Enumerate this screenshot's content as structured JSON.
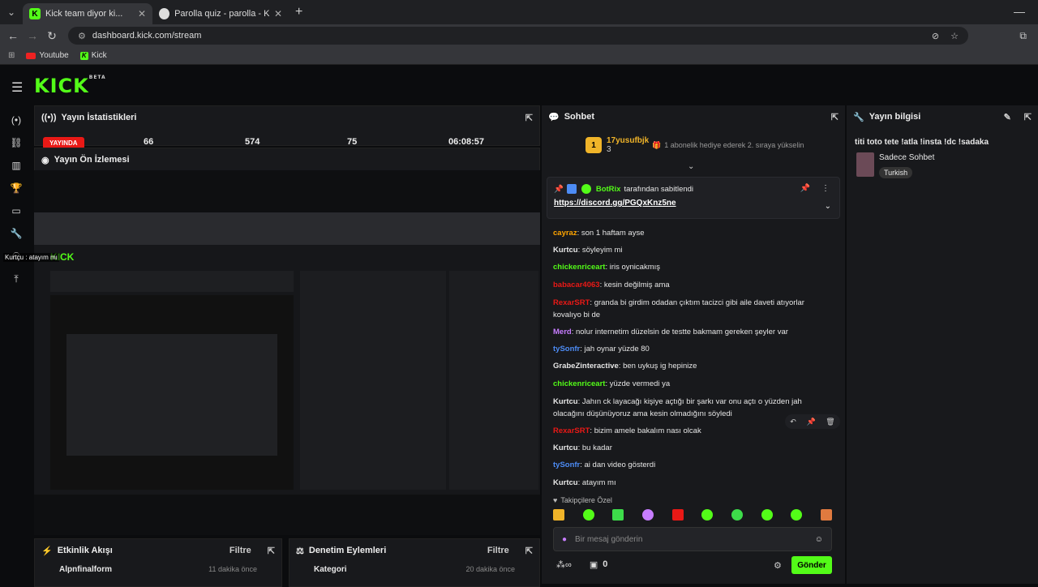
{
  "browser": {
    "tabs": [
      {
        "label": "Kick team diyor ki...",
        "active": true
      },
      {
        "label": "Parolla quiz - parolla - Kelime o",
        "active": false
      }
    ],
    "url": "dashboard.kick.com/stream",
    "bookmarks": [
      {
        "label": "Youtube"
      },
      {
        "label": "Kick"
      }
    ]
  },
  "brand": {
    "logo": "KICK",
    "beta": "BETA",
    "accent": "#53fc18"
  },
  "stats": {
    "title": "Yayın İstatistikleri",
    "live": "YAYINDA",
    "values": [
      "66",
      "574",
      "75",
      "06:08:57"
    ]
  },
  "preview": {
    "title": "Yayın Ön İzlemesi",
    "overlay": "Kurtçu : atayım mı"
  },
  "chat": {
    "title": "Sohbet",
    "top_user": "17yusufbjk",
    "top_count": "3",
    "sub_hint": "1 abonelik hediye ederek 2. sıraya yükselin",
    "pinned_by": "BotRix",
    "pinned_suffix": "tarafından sabitlendi",
    "pinned_link": "https://discord.gg/PGQxKnz5ne",
    "messages": [
      {
        "user": "cayraz",
        "text": ": son 1 haftam ayse",
        "color": "#ffa500"
      },
      {
        "user": "Kurtcu",
        "text": ": söyleyim mi",
        "color": "#e6e6e6"
      },
      {
        "user": "chickenriceart",
        "text": ": iris oynicakmış",
        "color": "#53fc18"
      },
      {
        "user": "babacar4063",
        "text": ": kesin değilmiş ama",
        "color": "#e91916"
      },
      {
        "user": "RexarSRT",
        "text": ": granda bi girdim odadan çıktım tacizci gibi aile daveti atıyorlar kovalıyo bi de",
        "color": "#e91916"
      },
      {
        "user": "Merd",
        "text": ": nolur internetim düzelsin de testte bakmam gereken şeyler var",
        "color": "#c77dff"
      },
      {
        "user": "tySonfr",
        "text": ": jah oynar yüzde 80",
        "color": "#4d8cf5"
      },
      {
        "user": "GrabeZinteractive",
        "text": ": ben uykuş ig hepinize",
        "color": "#e6e6e6"
      },
      {
        "user": "chickenriceart",
        "text": ": yüzde vermedi ya",
        "color": "#53fc18"
      },
      {
        "user": "Kurtcu",
        "text": ": Jahın ck layacağı kişiye açtığı bir şarkı var onu açtı o yüzden jah olacağını düşünüyoruz ama kesin olmadığını söyledi",
        "color": "#e6e6e6"
      },
      {
        "user": "RexarSRT",
        "text": ": bizim amele bakalım nası olcak",
        "color": "#e91916"
      },
      {
        "user": "Kurtcu",
        "text": ": bu kadar",
        "color": "#e6e6e6"
      },
      {
        "user": "tySonfr",
        "text": ": ai dan video gösterdi",
        "color": "#4d8cf5"
      },
      {
        "user": "Kurtcu",
        "text": ": atayım mı",
        "color": "#e6e6e6"
      }
    ],
    "emote_label": "Takipçilere Özel",
    "input_placeholder": "Bir mesaj gönderin",
    "send": "Gönder",
    "zero": "0"
  },
  "info": {
    "title": "Yayın bilgisi",
    "stream_title": "titi toto tete !atla !insta !dc !sadaka",
    "category": "Sadece Sohbet",
    "lang": "Turkish"
  },
  "bottom": {
    "activity": "Etkinlik Akışı",
    "moderation": "Denetim Eylemleri",
    "filter": "Filtre",
    "a_item": "Alpnfinalform",
    "a_time": "11 dakika önce",
    "m_item": "Kategori",
    "m_time": "20 dakika önce"
  }
}
